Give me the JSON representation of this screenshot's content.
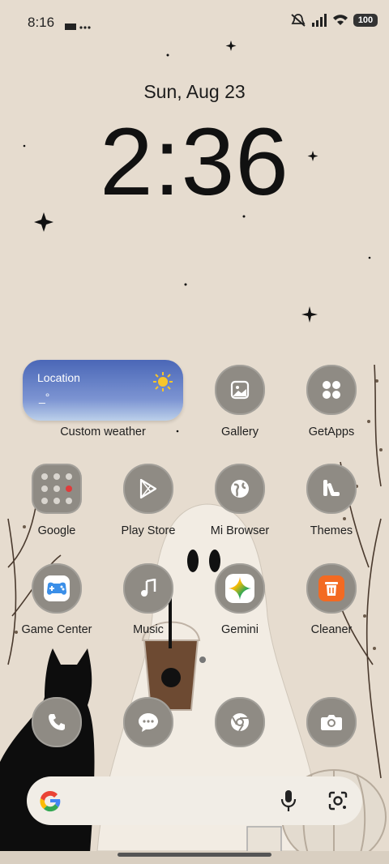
{
  "status_bar": {
    "time": "8:16",
    "battery": "100"
  },
  "lockscreen": {
    "date": "Sun, Aug 23",
    "time": "2:36"
  },
  "weather_widget": {
    "location": "Location",
    "temp": "_°",
    "label": "Custom weather"
  },
  "apps": {
    "gallery": "Gallery",
    "getapps": "GetApps",
    "google": "Google",
    "play_store": "Play Store",
    "mi_browser": "Mi Browser",
    "themes": "Themes",
    "game_center": "Game Center",
    "music": "Music",
    "gemini": "Gemini",
    "cleaner": "Cleaner"
  },
  "dock": [
    "phone",
    "messaging",
    "chrome",
    "camera"
  ],
  "colors": {
    "icon_tile": "#8f8b84",
    "weather_top": "#4a67b7",
    "cleaner_orange": "#f36a22"
  }
}
